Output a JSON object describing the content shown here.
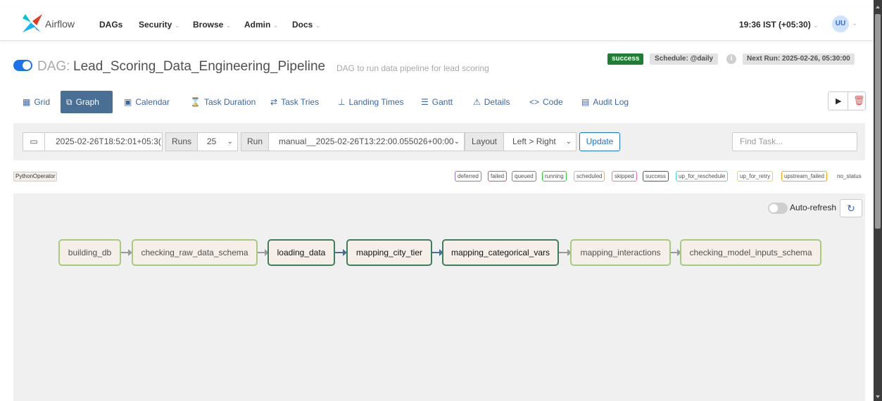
{
  "nav": {
    "brand": "Airflow",
    "items": [
      "DAGs",
      "Security",
      "Browse",
      "Admin",
      "Docs"
    ],
    "time": "19:36 IST (+05:30)",
    "user_initials": "UU"
  },
  "header": {
    "dag_prefix": "DAG:",
    "dag_id": "Lead_Scoring_Data_Engineering_Pipeline",
    "description": "DAG to run data pipeline for lead scoring",
    "status": "success",
    "schedule": "Schedule: @daily",
    "next_run": "Next Run: 2025-02-26, 05:30:00"
  },
  "tabs": [
    "Grid",
    "Graph",
    "Calendar",
    "Task Duration",
    "Task Tries",
    "Landing Times",
    "Gantt",
    "Details",
    "Code",
    "Audit Log"
  ],
  "filters": {
    "base_date": "2025-02-26T18:52:01+05:3(",
    "runs_label": "Runs",
    "runs_value": "25",
    "run_label": "Run",
    "run_value": "manual__2025-02-26T13:22:00.055026+00:00",
    "layout_label": "Layout",
    "layout_value": "Left > Right",
    "update_label": "Update",
    "find_task_placeholder": "Find Task..."
  },
  "legend": {
    "operator": "PythonOperator",
    "states": [
      "deferred",
      "failed",
      "queued",
      "running",
      "scheduled",
      "skipped",
      "success",
      "up_for_reschedule",
      "up_for_retry",
      "upstream_failed",
      "no_status"
    ]
  },
  "graph": {
    "auto_refresh_label": "Auto-refresh",
    "tasks": [
      "building_db",
      "checking_raw_data_schema",
      "loading_data",
      "mapping_city_tier",
      "mapping_categorical_vars",
      "mapping_interactions",
      "checking_model_inputs_schema"
    ]
  },
  "colors": {
    "accent": "#1a73e8",
    "active_tab": "#4a6f95",
    "success": "#1e7e34",
    "node_fill": "#f6efe9",
    "node_border_light": "#a5cc78",
    "node_border_dark": "#3c7f5b"
  },
  "icons": [
    "grid-icon",
    "graph-icon",
    "calendar-icon",
    "hourglass-icon",
    "retry-icon",
    "landing-icon",
    "gantt-icon",
    "warning-icon",
    "code-icon",
    "audit-icon",
    "play-icon",
    "trash-icon",
    "refresh-icon",
    "info-icon"
  ]
}
